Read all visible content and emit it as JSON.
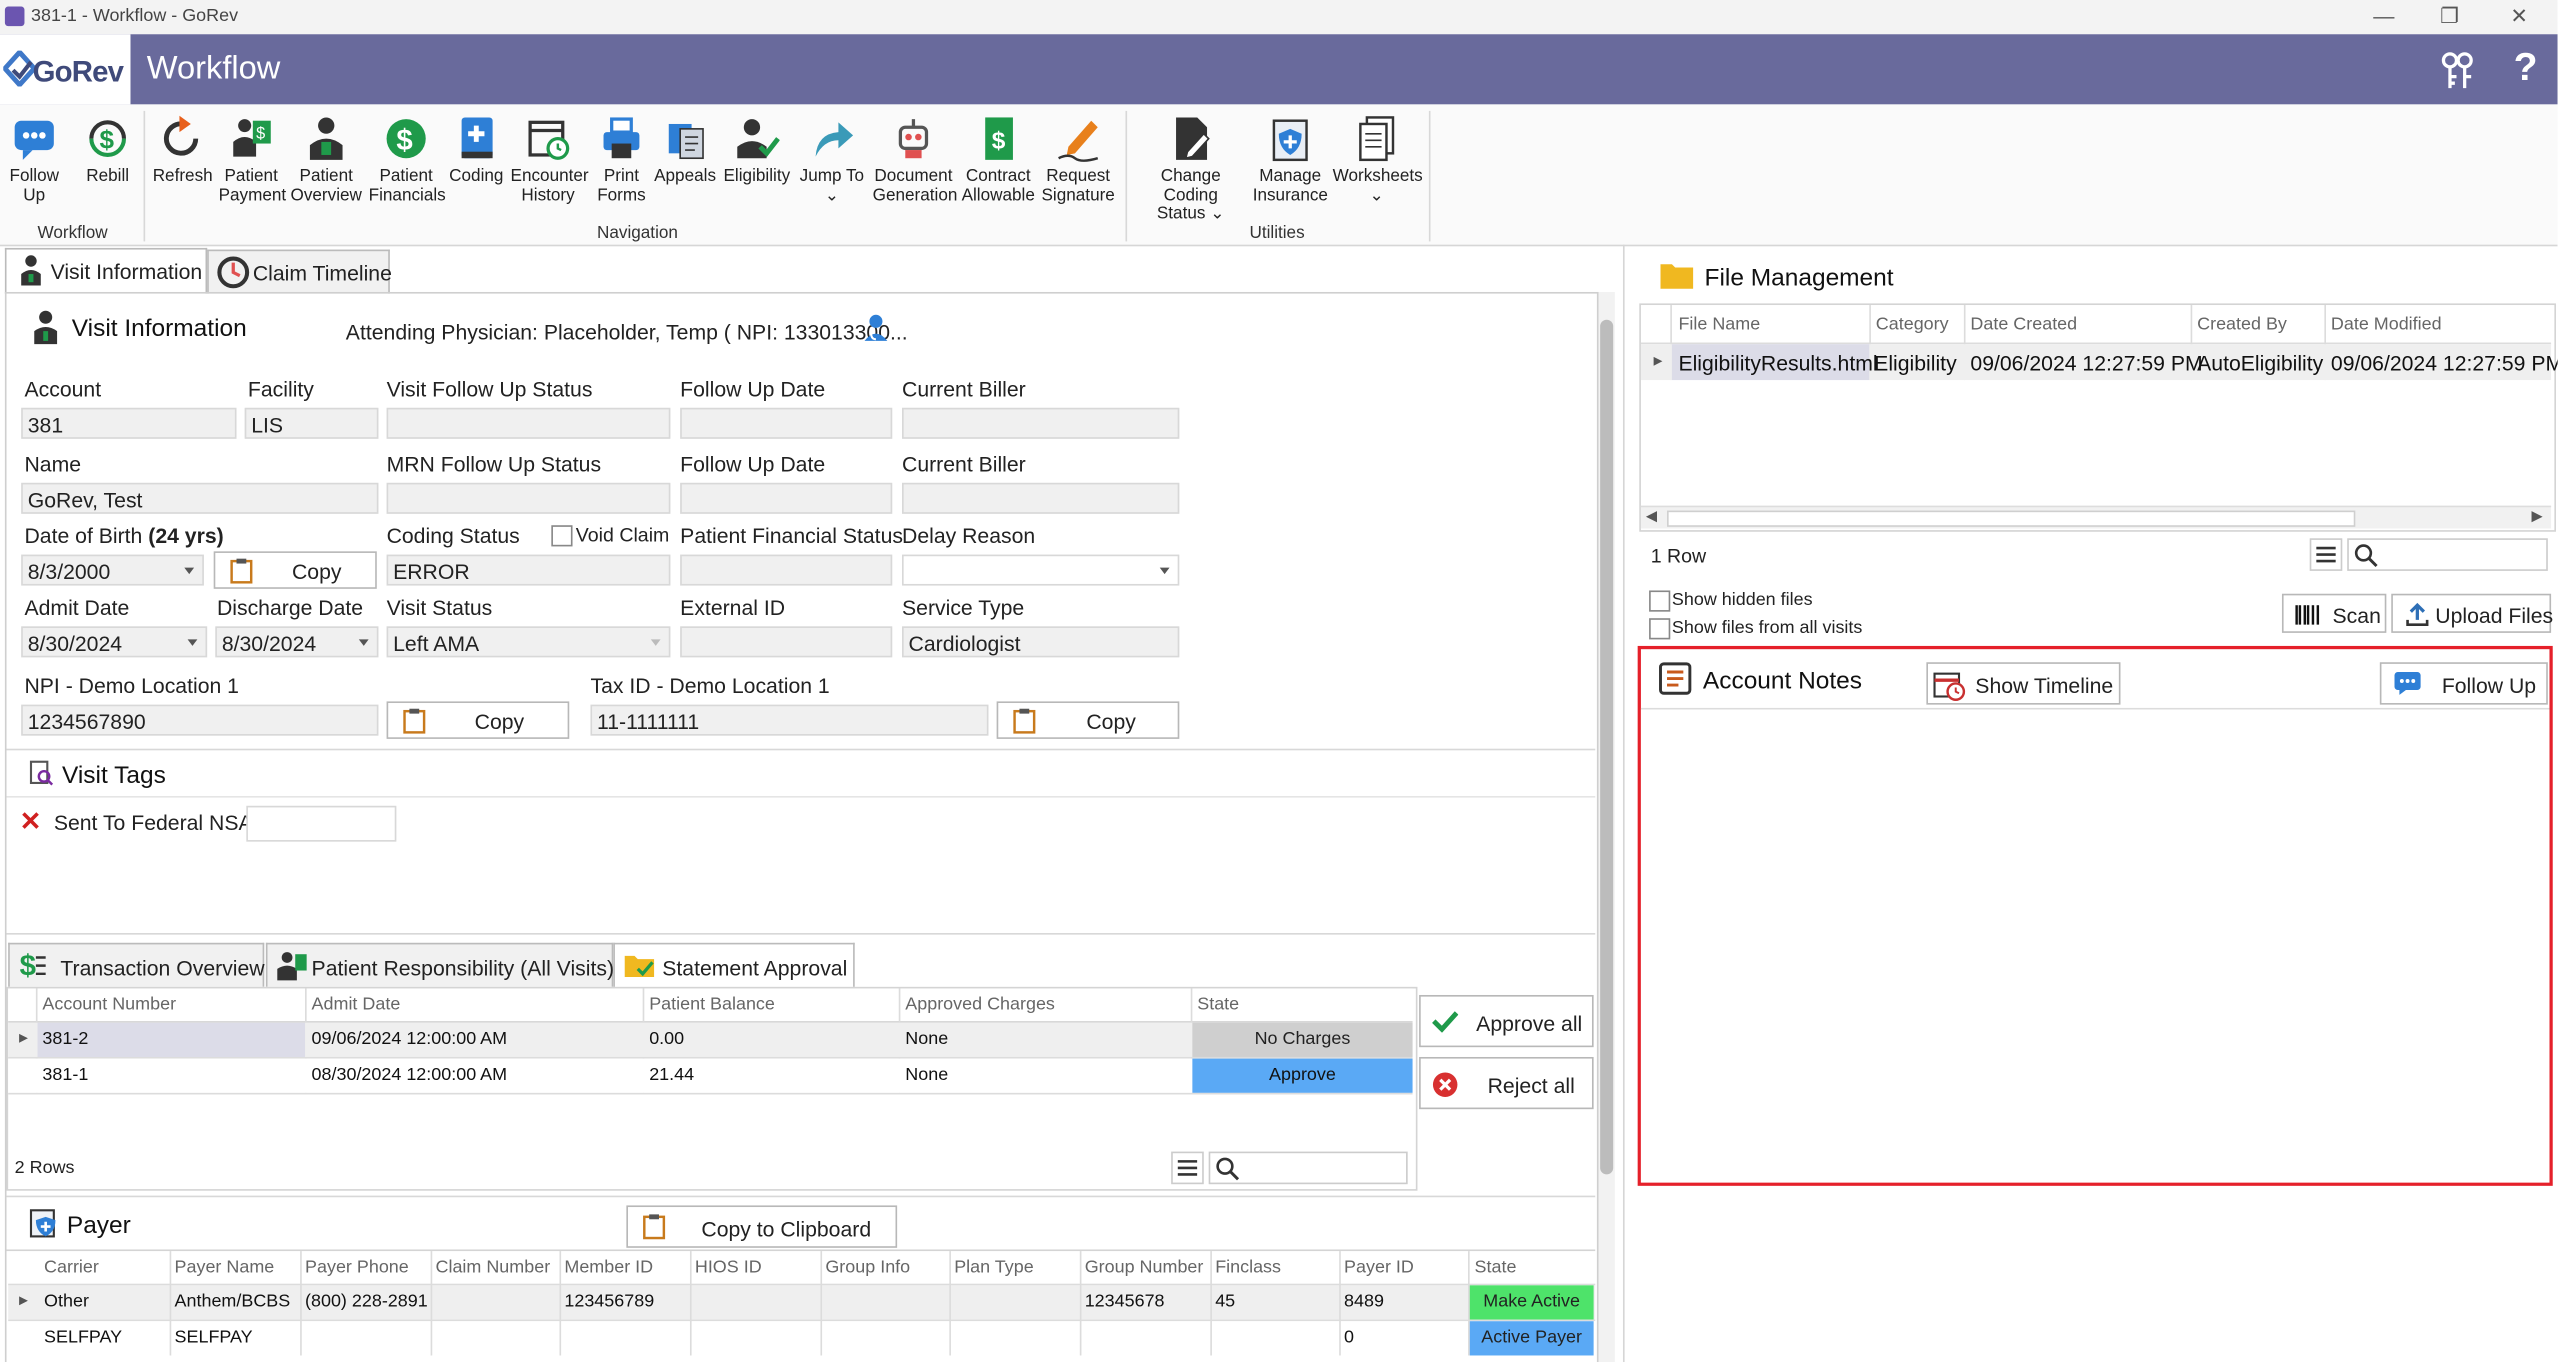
{
  "window": {
    "title": "381-1 - Workflow - GoRev"
  },
  "header": {
    "logo_text": "GoRev",
    "app_title": "Workflow",
    "help_glyph": "?"
  },
  "ribbon": {
    "groups": {
      "workflow": "Workflow",
      "navigation": "Navigation",
      "utilities": "Utilities"
    },
    "buttons": {
      "follow_up": [
        "Follow",
        "Up"
      ],
      "rebill": [
        "Rebill"
      ],
      "refresh": [
        "Refresh"
      ],
      "patient_payment": [
        "Patient",
        "Payment"
      ],
      "patient_overview": [
        "Patient",
        "Overview"
      ],
      "patient_financials": [
        "Patient",
        "Financials"
      ],
      "coding": [
        "Coding"
      ],
      "encounter_history": [
        "Encounter",
        "History"
      ],
      "print_forms": [
        "Print",
        "Forms"
      ],
      "appeals": [
        "Appeals"
      ],
      "eligibility": [
        "Eligibility"
      ],
      "jump_to": [
        "Jump To"
      ],
      "document_generation": [
        "Document",
        "Generation"
      ],
      "contract_allowable": [
        "Contract",
        "Allowable"
      ],
      "request_signature": [
        "Request",
        "Signature"
      ],
      "change_coding_status": [
        "Change Coding",
        "Status"
      ],
      "manage_insurance": [
        "Manage",
        "Insurance"
      ],
      "worksheets": [
        "Worksheets"
      ]
    }
  },
  "tabs": {
    "visit_information": "Visit Information",
    "claim_timeline": "Claim Timeline"
  },
  "visit": {
    "title": "Visit Information",
    "attending": "Attending Physician: Placeholder, Temp ( NPI: 133013300...",
    "labels": {
      "account": "Account",
      "facility": "Facility",
      "visit_follow_up_status": "Visit Follow Up Status",
      "follow_up_date": "Follow Up Date",
      "current_biller": "Current Biller",
      "name": "Name",
      "mrn_follow_up_status": "MRN Follow Up Status",
      "dob": "Date of Birth",
      "dob_age": "(24 yrs)",
      "coding_status": "Coding Status",
      "void_claim": "Void Claim",
      "patient_financial_status": "Patient Financial Status",
      "delay_reason": "Delay Reason",
      "admit_date": "Admit Date",
      "discharge_date": "Discharge Date",
      "visit_status": "Visit Status",
      "external_id": "External ID",
      "service_type": "Service Type",
      "npi": "NPI - Demo Location 1",
      "tax_id": "Tax ID - Demo Location 1"
    },
    "values": {
      "account": "381",
      "facility": "LIS",
      "visit_follow_up_status": "",
      "follow_up_date": "",
      "current_biller": "",
      "name": "GoRev, Test",
      "mrn_follow_up_status": "",
      "mrn_follow_up_date": "",
      "mrn_current_biller": "",
      "dob": "8/3/2000",
      "coding_status": "ERROR",
      "patient_financial_status": "",
      "delay_reason": "",
      "admit_date": "8/30/2024",
      "discharge_date": "8/30/2024",
      "visit_status": "Left AMA",
      "external_id": "",
      "service_type": "Cardiologist",
      "npi": "1234567890",
      "tax_id": "11-1111111"
    },
    "copy_label": "Copy"
  },
  "visit_tags": {
    "title": "Visit Tags",
    "tag": "Sent To Federal NSA",
    "tag_value": ""
  },
  "lower_tabs": {
    "transaction_overview": "Transaction Overview",
    "patient_responsibility": "Patient Responsibility (All Visits)",
    "statement_approval": "Statement Approval"
  },
  "statement_grid": {
    "columns": [
      "Account Number",
      "Admit Date",
      "Patient Balance",
      "Approved Charges",
      "State"
    ],
    "rows": [
      {
        "account": "381-2",
        "admit": "09/06/2024 12:00:00 AM",
        "balance": "0.00",
        "charges": "None",
        "state": "No Charges"
      },
      {
        "account": "381-1",
        "admit": "08/30/2024 12:00:00 AM",
        "balance": "21.44",
        "charges": "None",
        "state": "Approve"
      }
    ],
    "row_count": "2 Rows",
    "approve_all": "Approve all",
    "reject_all": "Reject all"
  },
  "payer": {
    "title": "Payer",
    "copy_clipboard": "Copy to Clipboard",
    "columns": [
      "Carrier",
      "Payer Name",
      "Payer Phone",
      "Claim Number",
      "Member ID",
      "HIOS ID",
      "Group Info",
      "Plan Type",
      "Group Number",
      "Finclass",
      "Payer ID",
      "State"
    ],
    "rows": [
      {
        "carrier": "Other",
        "payer_name": "Anthem/BCBS",
        "phone": "(800) 228-2891",
        "claim": "",
        "member": "123456789",
        "hios": "",
        "group_info": "",
        "plan": "",
        "group_number": "12345678",
        "finclass": "45",
        "payer_id": "8489",
        "state": "Make Active"
      },
      {
        "carrier": "SELFPAY",
        "payer_name": "SELFPAY",
        "phone": "",
        "claim": "",
        "member": "",
        "hios": "",
        "group_info": "",
        "plan": "",
        "group_number": "",
        "finclass": "",
        "payer_id": "0",
        "state": "Active Payer"
      }
    ]
  },
  "file_management": {
    "title": "File Management",
    "columns": [
      "File Name",
      "Category",
      "Date Created",
      "Created By",
      "Date Modified"
    ],
    "rows": [
      {
        "file": "EligibilityResults.html",
        "category": "Eligibility",
        "created": "09/06/2024 12:27:59 PM",
        "by": "AutoEligibility",
        "modified": "09/06/2024 12:27:59 PM"
      }
    ],
    "row_count": "1 Row",
    "show_hidden": "Show hidden files",
    "show_all_visits": "Show files from all visits",
    "scan": "Scan",
    "upload": "Upload Files"
  },
  "account_notes": {
    "title": "Account Notes",
    "show_timeline": "Show Timeline",
    "follow_up": "Follow Up"
  },
  "colors": {
    "header": "#696a9c",
    "approve": "#5aa9f5",
    "no_charges": "#cfcfcf",
    "make_active": "#4ee36a",
    "active_payer": "#5aa9f5",
    "highlight": "#e5202a",
    "accent_green": "#1f9a4a"
  }
}
